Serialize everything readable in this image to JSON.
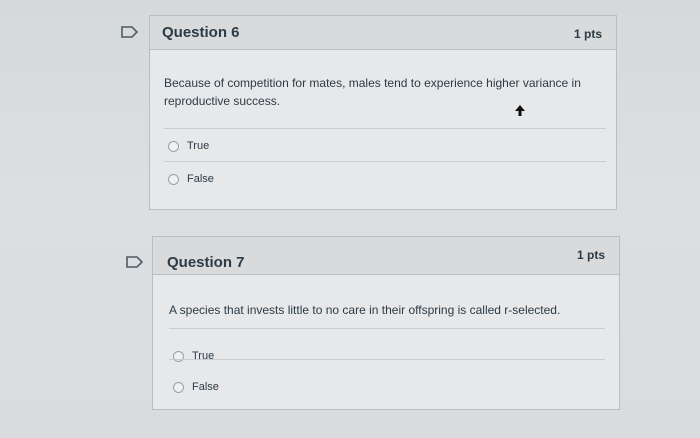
{
  "questions": [
    {
      "title": "Question 6",
      "points": "1 pts",
      "text": "Because of competition for mates, males tend to experience higher variance in reproductive success.",
      "answers": [
        "True",
        "False"
      ]
    },
    {
      "title": "Question 7",
      "points": "1 pts",
      "text": "A species that invests little to no care in their offspring is called r-selected.",
      "answers": [
        "True",
        "False"
      ]
    }
  ],
  "icons": {
    "flag": "flag-question-icon",
    "cursor": "mouse-pointer-icon"
  },
  "colors": {
    "flag_outline": "#5a6570",
    "header_bg": "#d8dadc",
    "card_bg": "#e6e8ea"
  }
}
